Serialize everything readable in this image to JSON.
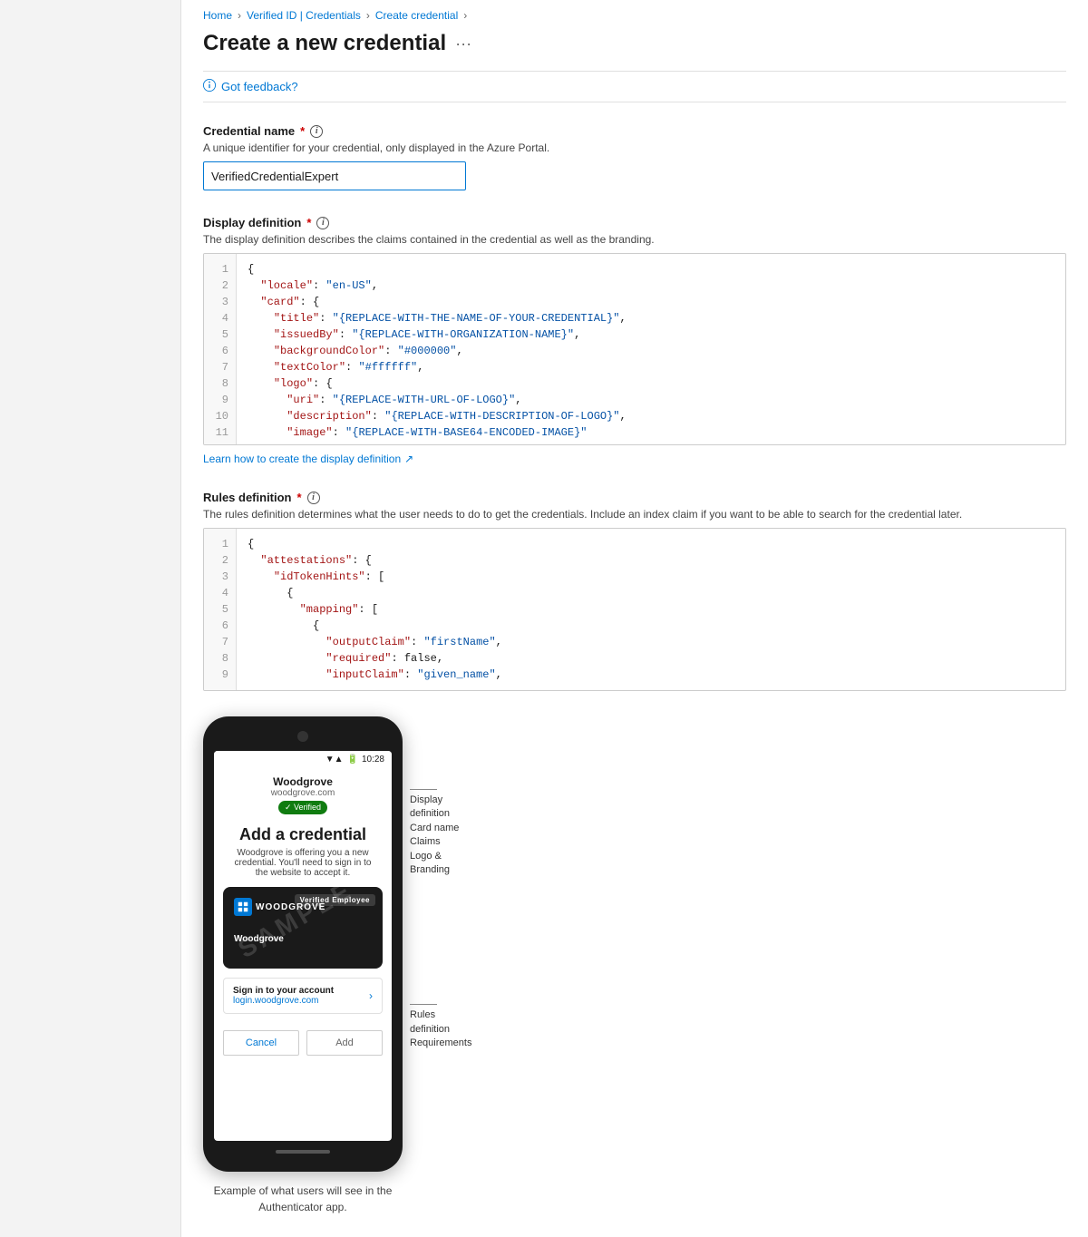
{
  "breadcrumb": {
    "items": [
      {
        "label": "Home",
        "link": true
      },
      {
        "label": "Verified ID | Credentials",
        "link": true
      },
      {
        "label": "Create credential",
        "link": true
      }
    ]
  },
  "page": {
    "title": "Create a new credential",
    "more_label": "···",
    "feedback_label": "Got feedback?"
  },
  "credential_name": {
    "label": "Credential name",
    "required": true,
    "description": "A unique identifier for your credential, only displayed in the Azure Portal.",
    "value": "VerifiedCredentialExpert",
    "placeholder": ""
  },
  "display_definition": {
    "label": "Display definition",
    "required": true,
    "description": "The display definition describes the claims contained in the credential as well as the branding.",
    "link_text": "Learn how to create the display definition",
    "code_lines": [
      {
        "num": 1,
        "text": "{"
      },
      {
        "num": 2,
        "text": "  \"locale\": \"en-US\","
      },
      {
        "num": 3,
        "text": "  \"card\": {"
      },
      {
        "num": 4,
        "text": "    \"title\": \"{REPLACE-WITH-THE-NAME-OF-YOUR-CREDENTIAL}\","
      },
      {
        "num": 5,
        "text": "    \"issuedBy\": \"{REPLACE-WITH-ORGANIZATION-NAME}\","
      },
      {
        "num": 6,
        "text": "    \"backgroundColor\": \"#000000\","
      },
      {
        "num": 7,
        "text": "    \"textColor\": \"#ffffff\","
      },
      {
        "num": 8,
        "text": "    \"logo\": {"
      },
      {
        "num": 9,
        "text": "      \"uri\": \"{REPLACE-WITH-URL-OF-LOGO}\","
      },
      {
        "num": 10,
        "text": "      \"description\": \"{REPLACE-WITH-DESCRIPTION-OF-LOGO}\","
      },
      {
        "num": 11,
        "text": "      \"image\": \"{REPLACE-WITH-BASE64-ENCODED-IMAGE}\""
      }
    ]
  },
  "rules_definition": {
    "label": "Rules definition",
    "required": true,
    "description": "The rules definition determines what the user needs to do to get the credentials. Include an index claim if you want to be able to search for the credential later.",
    "code_lines": [
      {
        "num": 1,
        "text": "{"
      },
      {
        "num": 2,
        "text": "  \"attestations\": {"
      },
      {
        "num": 3,
        "text": "    \"idTokenHints\": ["
      },
      {
        "num": 4,
        "text": "      {"
      },
      {
        "num": 5,
        "text": "        \"mapping\": ["
      },
      {
        "num": 6,
        "text": "          {"
      },
      {
        "num": 7,
        "text": "            \"outputClaim\": \"firstName\","
      },
      {
        "num": 8,
        "text": "            \"required\": false,"
      },
      {
        "num": 9,
        "text": "            \"inputClaim\": \"given_name\","
      }
    ]
  },
  "phone_mockup": {
    "time": "10:28",
    "org_name": "Woodgrove",
    "org_url": "woodgrove.com",
    "verified_label": "✓ Verified",
    "add_title": "Add a credential",
    "add_desc": "Woodgrove is offering you a new credential. You'll need to sign in to the website to accept it.",
    "card_badge": "Verified Employee",
    "card_logo_text": "WOODGROVE",
    "card_org": "Woodgrove",
    "sample_text": "SAMPLE",
    "sign_in_label": "Sign in to your account",
    "sign_in_url": "login.woodgrove.com",
    "cancel_btn": "Cancel",
    "add_btn": "Add",
    "example_text": "Example of what users will see in the\nAuthenticator app."
  },
  "annotations": {
    "display_def": {
      "lines": [
        "Display",
        "definition",
        "Card name",
        "Claims",
        "Logo &",
        "Branding"
      ]
    },
    "rules_def": {
      "lines": [
        "Rules",
        "definition",
        "Requirements"
      ]
    }
  }
}
